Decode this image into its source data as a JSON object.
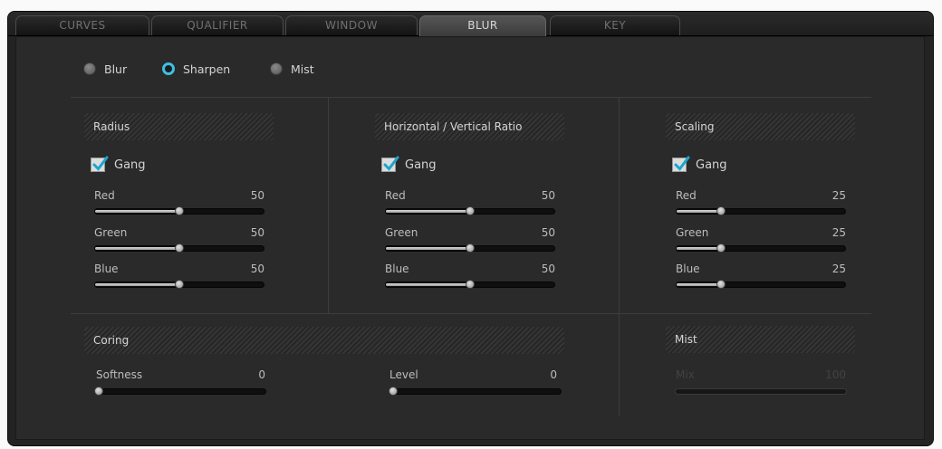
{
  "tabs": [
    {
      "label": "CURVES",
      "active": false
    },
    {
      "label": "QUALIFIER",
      "active": false
    },
    {
      "label": "WINDOW",
      "active": false
    },
    {
      "label": "BLUR",
      "active": true
    },
    {
      "label": "KEY",
      "active": false
    }
  ],
  "modes": [
    {
      "label": "Blur",
      "selected": false
    },
    {
      "label": "Sharpen",
      "selected": true
    },
    {
      "label": "Mist",
      "selected": false
    }
  ],
  "groups": [
    {
      "title": "Radius",
      "gang_label": "Gang",
      "gang_checked": true,
      "channels": [
        {
          "label": "Red",
          "value": "50",
          "fraction": 0.5
        },
        {
          "label": "Green",
          "value": "50",
          "fraction": 0.5
        },
        {
          "label": "Blue",
          "value": "50",
          "fraction": 0.5
        }
      ]
    },
    {
      "title": "Horizontal / Vertical Ratio",
      "gang_label": "Gang",
      "gang_checked": true,
      "channels": [
        {
          "label": "Red",
          "value": "50",
          "fraction": 0.5
        },
        {
          "label": "Green",
          "value": "50",
          "fraction": 0.5
        },
        {
          "label": "Blue",
          "value": "50",
          "fraction": 0.5
        }
      ]
    },
    {
      "title": "Scaling",
      "gang_label": "Gang",
      "gang_checked": true,
      "channels": [
        {
          "label": "Red",
          "value": "25",
          "fraction": 0.25
        },
        {
          "label": "Green",
          "value": "25",
          "fraction": 0.25
        },
        {
          "label": "Blue",
          "value": "25",
          "fraction": 0.25
        }
      ]
    }
  ],
  "coring": {
    "title": "Coring",
    "softness": {
      "label": "Softness",
      "value": "0",
      "fraction": 0
    },
    "level": {
      "label": "Level",
      "value": "0",
      "fraction": 0
    }
  },
  "mist": {
    "title": "Mist",
    "mix": {
      "label": "Mix",
      "value": "100",
      "fraction": 1,
      "enabled": false
    }
  },
  "colors": {
    "accent": "#3cc0e4",
    "panel": "#2a2a2a",
    "frame": "#232323"
  }
}
